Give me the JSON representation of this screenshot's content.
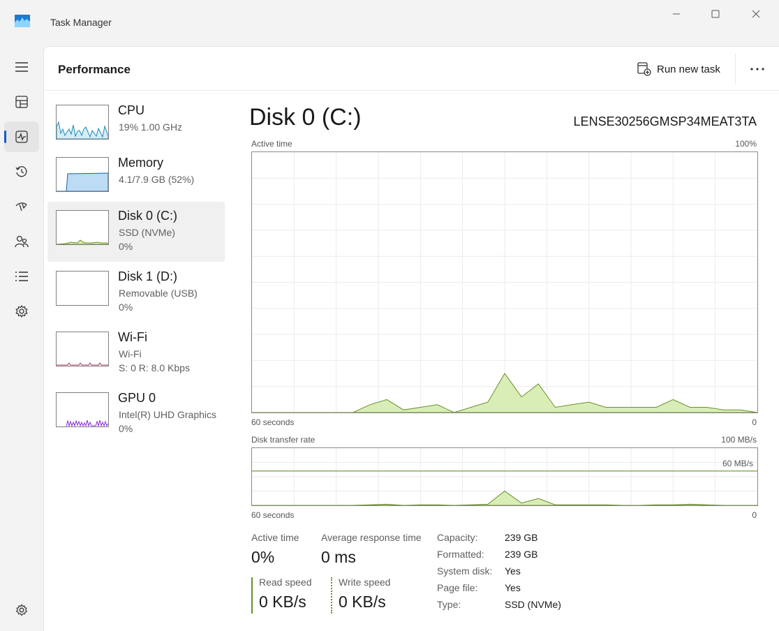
{
  "window": {
    "title": "Task Manager"
  },
  "header": {
    "title": "Performance",
    "run_new_task": "Run new task"
  },
  "sidebar": [
    {
      "name": "CPU",
      "line1": "19%  1.00 GHz",
      "line2": ""
    },
    {
      "name": "Memory",
      "line1": "4.1/7.9 GB (52%)",
      "line2": ""
    },
    {
      "name": "Disk 0 (C:)",
      "line1": "SSD (NVMe)",
      "line2": "0%"
    },
    {
      "name": "Disk 1 (D:)",
      "line1": "Removable (USB)",
      "line2": "0%"
    },
    {
      "name": "Wi-Fi",
      "line1": "Wi-Fi",
      "line2": "S: 0 R: 8.0 Kbps"
    },
    {
      "name": "GPU 0",
      "line1": "Intel(R) UHD Graphics",
      "line2": "0%"
    }
  ],
  "main": {
    "title": "Disk 0 (C:)",
    "model": "LENSE30256GMSP34MEAT3TA",
    "active_graph": {
      "label": "Active time",
      "max": "100%",
      "time": "60 seconds",
      "min": "0"
    },
    "transfer_graph": {
      "label": "Disk transfer rate",
      "max": "100 MB/s",
      "line_label": "60 MB/s",
      "time": "60 seconds",
      "min": "0"
    }
  },
  "stats": {
    "active_time_label": "Active time",
    "active_time": "0%",
    "avg_response_label": "Average response time",
    "avg_response": "0 ms",
    "read_label": "Read speed",
    "read": "0 KB/s",
    "write_label": "Write speed",
    "write": "0 KB/s"
  },
  "properties": [
    {
      "label": "Capacity:",
      "value": "239 GB"
    },
    {
      "label": "Formatted:",
      "value": "239 GB"
    },
    {
      "label": "System disk:",
      "value": "Yes"
    },
    {
      "label": "Page file:",
      "value": "Yes"
    },
    {
      "label": "Type:",
      "value": "SSD (NVMe)"
    }
  ],
  "chart_data": [
    {
      "type": "area",
      "ylabel": "Active time",
      "ylim": [
        0,
        100
      ],
      "xlim": [
        60,
        0
      ],
      "x": [
        60,
        58,
        56,
        54,
        52,
        50,
        48,
        46,
        44,
        42,
        40,
        38,
        36,
        34,
        32,
        30,
        28,
        26,
        24,
        22,
        20,
        18,
        16,
        14,
        12,
        10,
        8,
        6,
        4,
        2,
        0
      ],
      "values": [
        0,
        0,
        0,
        0,
        0,
        0,
        0,
        3,
        5,
        1,
        2,
        3,
        0,
        2,
        4,
        15,
        6,
        11,
        2,
        3,
        4,
        2,
        2,
        2,
        2,
        5,
        2,
        2,
        1,
        1,
        0
      ]
    },
    {
      "type": "area",
      "ylabel": "Disk transfer rate",
      "ylim": [
        0,
        100
      ],
      "xlim": [
        60,
        0
      ],
      "x": [
        60,
        58,
        56,
        54,
        52,
        50,
        48,
        46,
        44,
        42,
        40,
        38,
        36,
        34,
        32,
        30,
        28,
        26,
        24,
        22,
        20,
        18,
        16,
        14,
        12,
        10,
        8,
        6,
        4,
        2,
        0
      ],
      "values": [
        0,
        0,
        0,
        0,
        0,
        0,
        0,
        1,
        2,
        0,
        1,
        1,
        0,
        1,
        2,
        25,
        4,
        12,
        1,
        1,
        1,
        1,
        0,
        0,
        1,
        1,
        2,
        1,
        0,
        0,
        0
      ],
      "reference_line": 60
    }
  ],
  "colors": {
    "accent": "#0f5fc4",
    "disk": "#6a8f2a",
    "disk_fill": "#d8eeb6",
    "cpu": "#1a8bb8",
    "memory": "#1a5fa8",
    "gpu": "#8a2be2",
    "wifi": "#a33a6a"
  }
}
